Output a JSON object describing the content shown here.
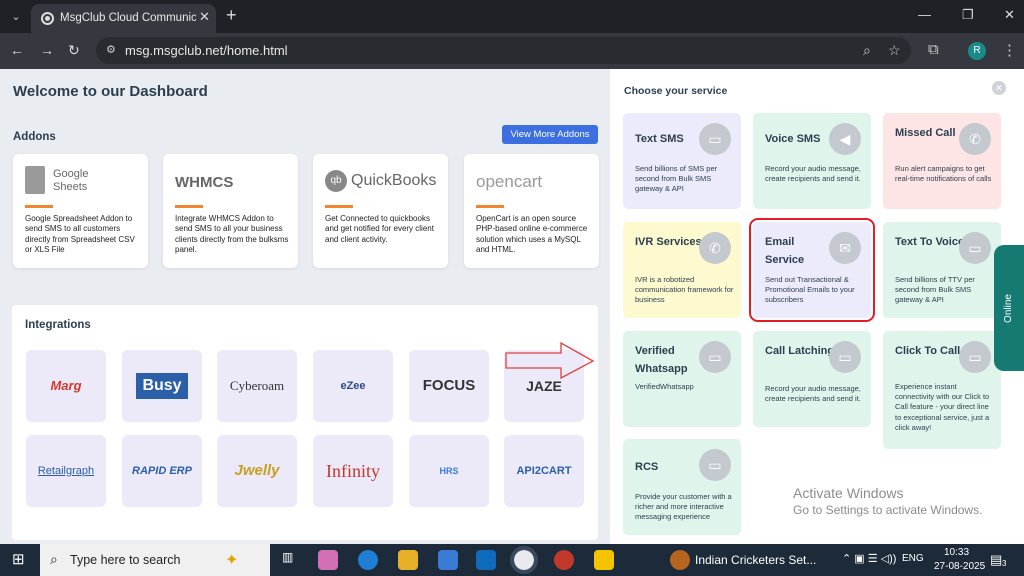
{
  "browser": {
    "tab_title": "MsgClub Cloud Communication",
    "url": "msg.msgclub.net/home.html",
    "avatar": "R"
  },
  "dashboard": {
    "title": "Welcome to our Dashboard"
  },
  "addons": {
    "title": "Addons",
    "view_more": "View More Addons",
    "items": [
      {
        "logo": "Google Sheets",
        "desc": "Google Spreadsheet Addon to send SMS to all customers directly from Spreadsheet CSV or XLS File"
      },
      {
        "logo": "WHMCS",
        "desc": "Integrate WHMCS Addon to send SMS to all your business clients directly from the bulksms panel."
      },
      {
        "logo": "QuickBooks",
        "desc": "Get Connected to quickbooks and get notified for every client and client activity."
      },
      {
        "logo": "opencart",
        "desc": "OpenCart is an open source PHP-based online e-commerce solution which uses a MySQL and HTML."
      }
    ]
  },
  "integrations": {
    "title": "Integrations",
    "logos": [
      "Marg",
      "Busy",
      "Cyberoam",
      "eZee",
      "FOCUS",
      "JAZE",
      "Retailgraph",
      "RAPID ERP",
      "Jwelly",
      "Infinity",
      "HRS",
      "API2CART"
    ]
  },
  "services": {
    "title": "Choose your service",
    "items": [
      {
        "name": "Text SMS",
        "desc": "Send billions of SMS per second from Bulk SMS gateway & API"
      },
      {
        "name": "Voice SMS",
        "desc": "Record your audio message, create recipients and send it."
      },
      {
        "name": "Missed Call",
        "desc": "Run alert campaigns to get real-time notifications of calls"
      },
      {
        "name": "IVR Services",
        "desc": "IVR is a robotized communication framework for business"
      },
      {
        "name": "Email Service",
        "desc": "Send out Transactional & Promotional Emails to your subscribers"
      },
      {
        "name": "Text To Voice",
        "desc": "Send billions of TTV per second from Bulk SMS gateway & API"
      },
      {
        "name": "Verified Whatsapp",
        "desc": "VerifiedWhatsapp"
      },
      {
        "name": "Call Latching",
        "desc": "Record your audio message, create recipients and send it."
      },
      {
        "name": "Click To Call",
        "desc": "Experience instant connectivity with our Click to Call feature - your direct line to exceptional service, just a click away!"
      },
      {
        "name": "RCS",
        "desc": "Provide your customer with a richer and more interactive messaging experience"
      }
    ]
  },
  "online_tab": "Online",
  "windows": {
    "activate": "Activate Windows",
    "activate_sub": "Go to Settings to activate Windows."
  },
  "taskbar": {
    "search": "Type here to search",
    "news": "Indian Cricketers Set...",
    "lang": "ENG",
    "time": "10:33",
    "date": "27-08-2025",
    "notif": "3"
  }
}
